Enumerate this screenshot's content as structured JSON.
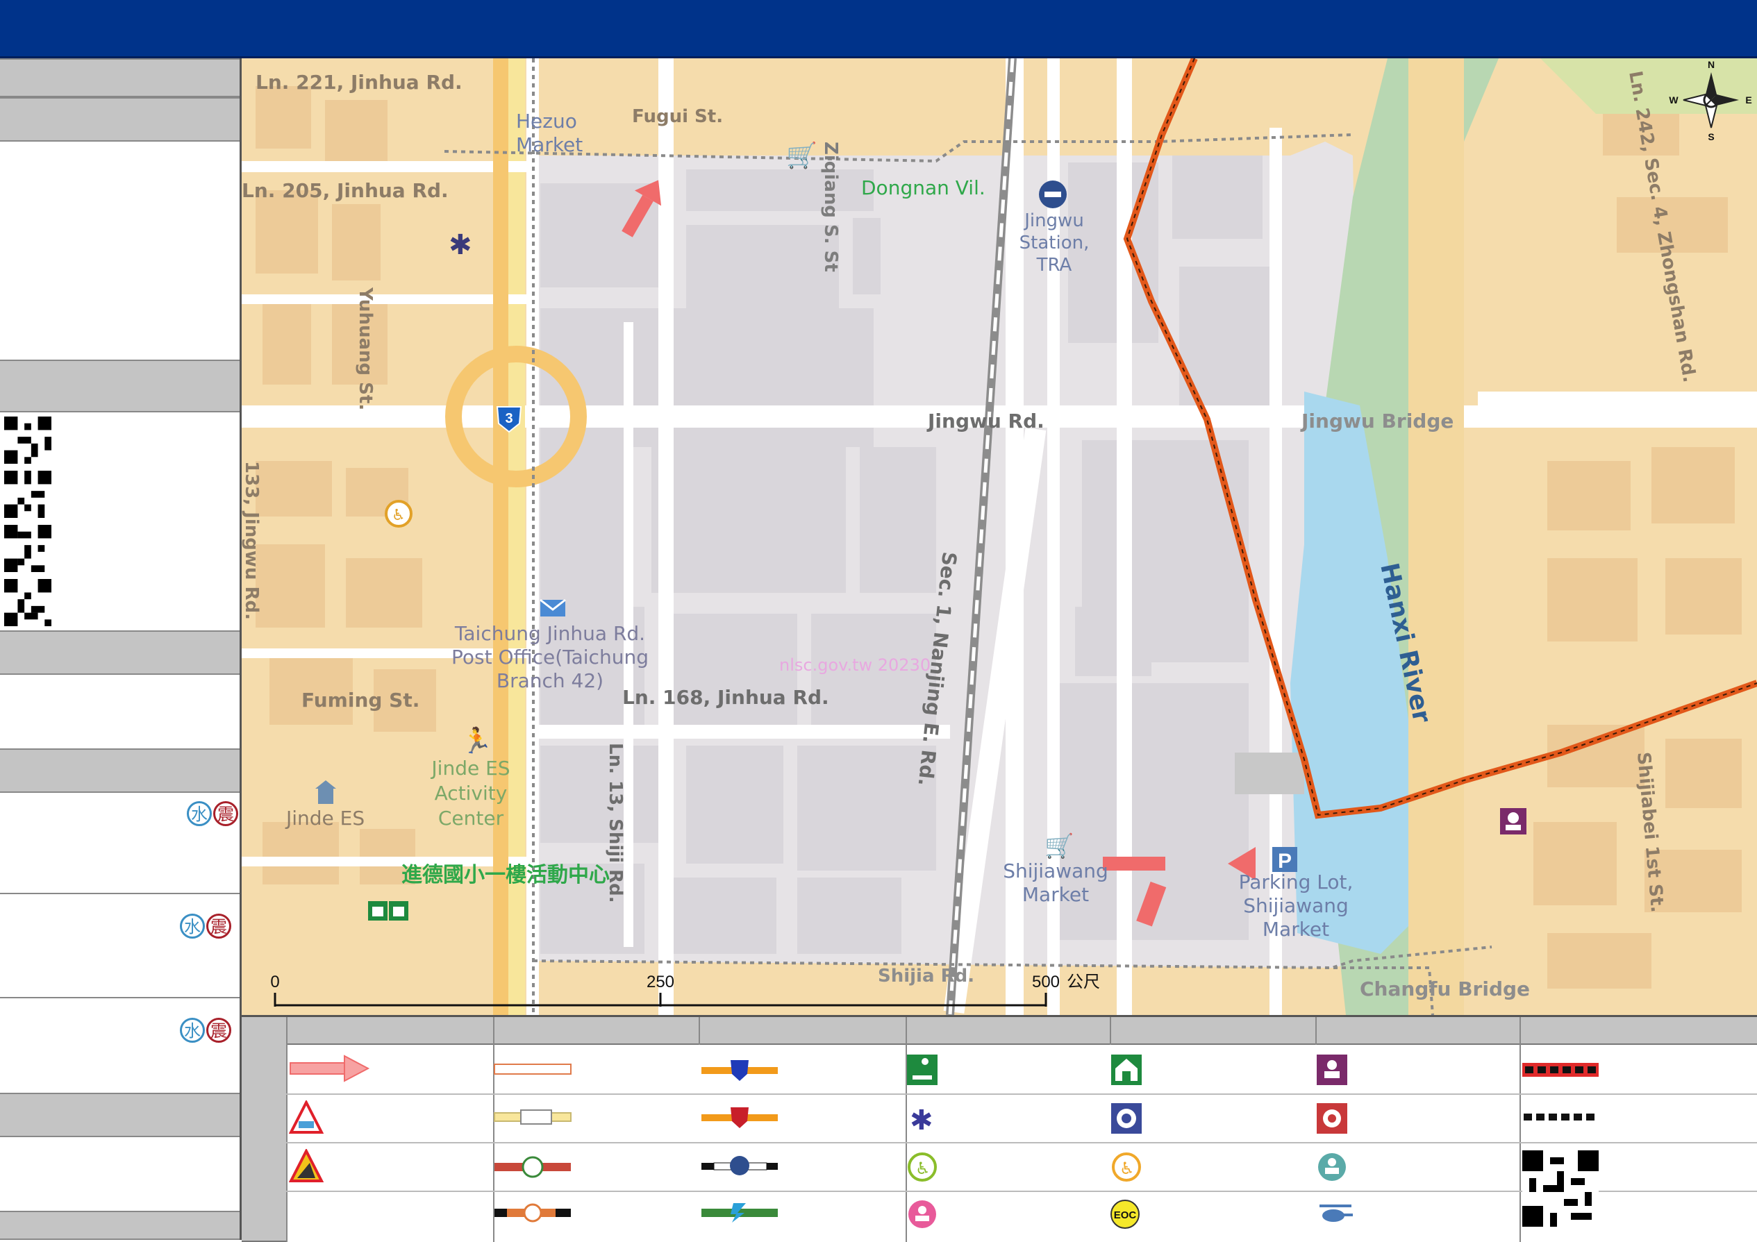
{
  "map": {
    "labels": {
      "ln221": "Ln. 221, Jinhua Rd.",
      "ln205": "Ln. 205, Jinhua Rd.",
      "hezuo": [
        "Hezuo",
        "Market"
      ],
      "fugui": "Fugui St.",
      "ziqiang": "Ziqiang S. St",
      "dongnan": "Dongnan Vil.",
      "jingwu_station": [
        "Jingwu",
        "Station,",
        "TRA"
      ],
      "yuhuang": "Yuhuang St.",
      "jingwu_rd": "Jingwu Rd.",
      "jingwu_bridge": "Jingwu Bridge",
      "ln242": "Ln. 242, Sec. 4, Zhongshan Rd.",
      "ln133": "133, Jingwu Rd.",
      "nanjing": "Sec. 1, Nanjing E. Rd.",
      "hanxi": "Hanxi River",
      "post_office": [
        "Taichung Jinhua Rd.",
        "Post Office(Taichung",
        "Branch 42)"
      ],
      "watermark": "nlsc.gov.tw 20230",
      "fuming": "Fuming St.",
      "ln168": "Ln. 168, Jinhua Rd.",
      "ln13": "Ln. 13, Shiji Rd.",
      "jinde_activity": [
        "Jinde ES",
        "Activity",
        "Center"
      ],
      "jinde_es": "Jinde ES",
      "shelter": "進德國小一樓活動中心",
      "shijiawang_market": [
        "Shijiawang",
        "Market"
      ],
      "parking": [
        "Parking Lot,",
        "Shijiawang",
        "Market"
      ],
      "shijia": "Shijia Rd.",
      "changfu": "Changfu Bridge",
      "shijiabei": "Shijiabei 1st St."
    },
    "route_shield": "3",
    "compass": {
      "n": "N",
      "s": "S",
      "e": "E",
      "w": "W"
    },
    "scale": {
      "t0": "0",
      "t250": "250",
      "t500": "500",
      "unit": "公尺"
    }
  },
  "sidebar": {
    "water_badge": "水",
    "quake_badge": "震"
  },
  "legend": {
    "eoc_label": "EOC"
  },
  "colors": {
    "banner": "#00338a",
    "river": "#a9d8ee",
    "boundary": "#e2581a",
    "evac_arrow": "#f06b6b"
  }
}
